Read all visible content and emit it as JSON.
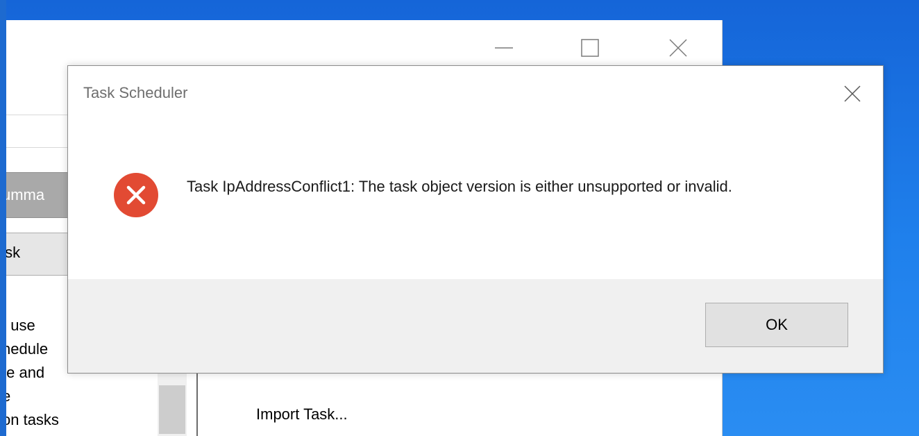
{
  "dialog": {
    "title": "Task Scheduler",
    "message": "Task IpAddressConflict1: The task object version is either unsupported or invalid.",
    "ok_label": "OK",
    "icon": "error-icon"
  },
  "background_window": {
    "summary_label": "umma",
    "task_button_label": "ısk",
    "description_lines": [
      "ı use",
      "hedule",
      "te and",
      "e",
      "on tasks"
    ],
    "action_item": "Import Task..."
  }
}
